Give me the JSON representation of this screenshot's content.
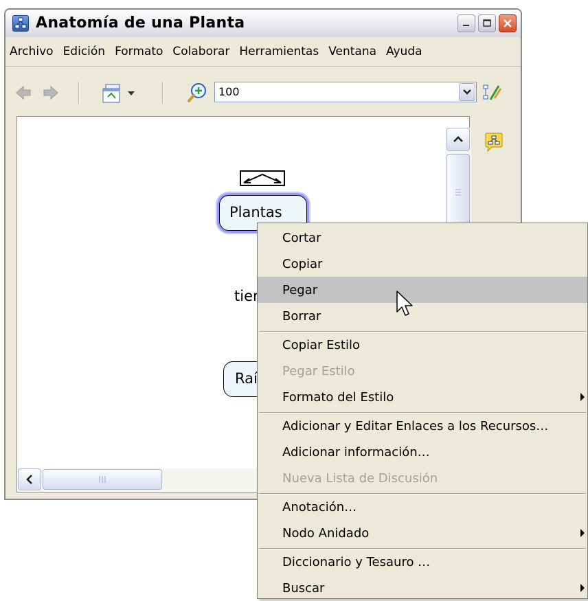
{
  "window": {
    "title": "Anatomía de una Planta"
  },
  "menubar": {
    "items": [
      "Archivo",
      "Edición",
      "Formato",
      "Colaborar",
      "Herramientas",
      "Ventana",
      "Ayuda"
    ]
  },
  "toolbar": {
    "zoom_value": "100"
  },
  "map": {
    "nodes": [
      {
        "label": "Plantas"
      },
      {
        "label": "Raí"
      }
    ],
    "link_text": "tier"
  },
  "context_menu": {
    "items": [
      {
        "label": "Cortar",
        "enabled": true,
        "submenu": false
      },
      {
        "label": "Copiar",
        "enabled": true,
        "submenu": false
      },
      {
        "label": "Pegar",
        "enabled": true,
        "submenu": false,
        "highlighted": true
      },
      {
        "label": "Borrar",
        "enabled": true,
        "submenu": false
      },
      {
        "label": "Copiar Estilo",
        "enabled": true,
        "submenu": false
      },
      {
        "label": "Pegar Estilo",
        "enabled": false,
        "submenu": false
      },
      {
        "label": "Formato del Estilo",
        "enabled": true,
        "submenu": true
      },
      {
        "label": "Adicionar y Editar Enlaces a los Recursos…",
        "enabled": true,
        "submenu": false
      },
      {
        "label": "Adicionar información…",
        "enabled": true,
        "submenu": false
      },
      {
        "label": "Nueva Lista de Discusión",
        "enabled": false,
        "submenu": false
      },
      {
        "label": "Anotación…",
        "enabled": true,
        "submenu": false
      },
      {
        "label": "Nodo Anidado",
        "enabled": true,
        "submenu": true
      },
      {
        "label": "Diccionario y Tesauro …",
        "enabled": true,
        "submenu": false
      },
      {
        "label": "Buscar",
        "enabled": true,
        "submenu": true
      }
    ]
  },
  "colors": {
    "window_bg": "#ece9d8",
    "selection_glow": "#9b9bff",
    "menu_highlight": "#c2c2c2",
    "disabled_text": "#a3a094"
  }
}
